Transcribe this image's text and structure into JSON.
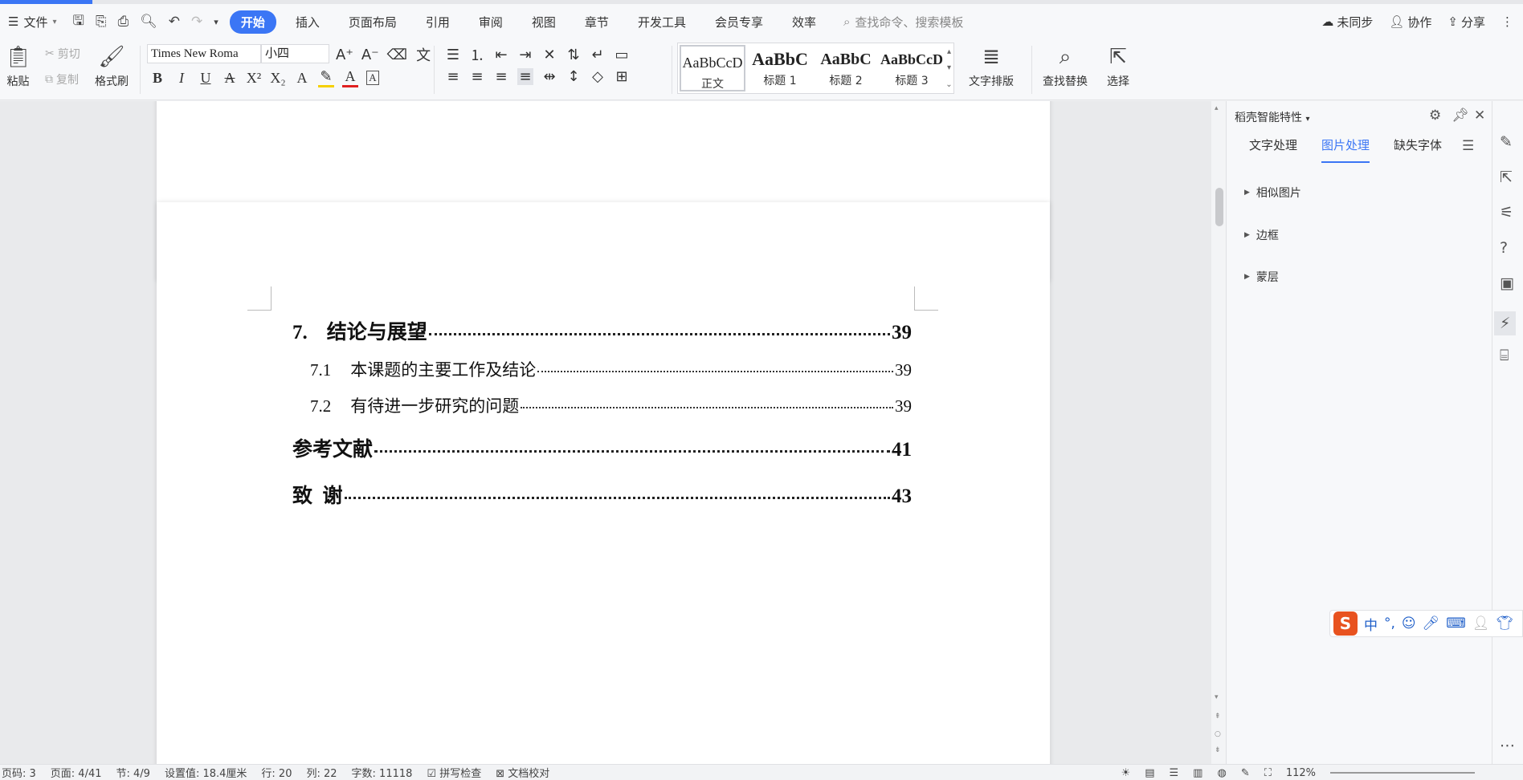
{
  "menubar": {
    "file_label": "文件",
    "tabs": [
      "开始",
      "插入",
      "页面布局",
      "引用",
      "审阅",
      "视图",
      "章节",
      "开发工具",
      "会员专享",
      "效率"
    ],
    "search_placeholder": "查找命令、搜索模板",
    "unsync": "未同步",
    "collab": "协作",
    "share": "分享"
  },
  "ribbon": {
    "paste": "粘贴",
    "cut": "剪切",
    "copy": "复制",
    "format_painter": "格式刷",
    "font_name": "Times New Roma",
    "font_size": "小四",
    "styles": [
      {
        "preview": "AaBbCcD",
        "name": "正文"
      },
      {
        "preview": "AaBbC",
        "name": "标题 1"
      },
      {
        "preview": "AaBbC",
        "name": "标题 2"
      },
      {
        "preview": "AaBbCcD",
        "name": "标题 3"
      }
    ],
    "text_layout": "文字排版",
    "find_replace": "查找替换",
    "select": "选择"
  },
  "document": {
    "toc": [
      {
        "level": 1,
        "num": "7.",
        "title": "结论与展望",
        "page": "39"
      },
      {
        "level": 2,
        "num": "7.1",
        "title": "本课题的主要工作及结论",
        "page": "39"
      },
      {
        "level": 2,
        "num": "7.2",
        "title": "有待进一步研究的问题",
        "page": "39"
      },
      {
        "level": 1,
        "num": "",
        "title": "参考文献",
        "page": "41"
      },
      {
        "level": 1,
        "num": "",
        "title": "致  谢",
        "page": "43"
      }
    ]
  },
  "panel": {
    "title": "稻壳智能特性",
    "tabs": [
      "文字处理",
      "图片处理",
      "缺失字体"
    ],
    "active_tab": "图片处理",
    "sections": [
      "相似图片",
      "边框",
      "蒙层"
    ]
  },
  "ime": {
    "logo": "S",
    "mode": "中"
  },
  "statusbar": {
    "pageno": "页码: 3",
    "page": "页面: 4/41",
    "section": "节: 4/9",
    "position": "设置值: 18.4厘米",
    "row": "行: 20",
    "col": "列: 22",
    "wordcount": "字数: 11118",
    "spell": "拼写检查",
    "proof": "文档校对",
    "zoom": "112%"
  }
}
